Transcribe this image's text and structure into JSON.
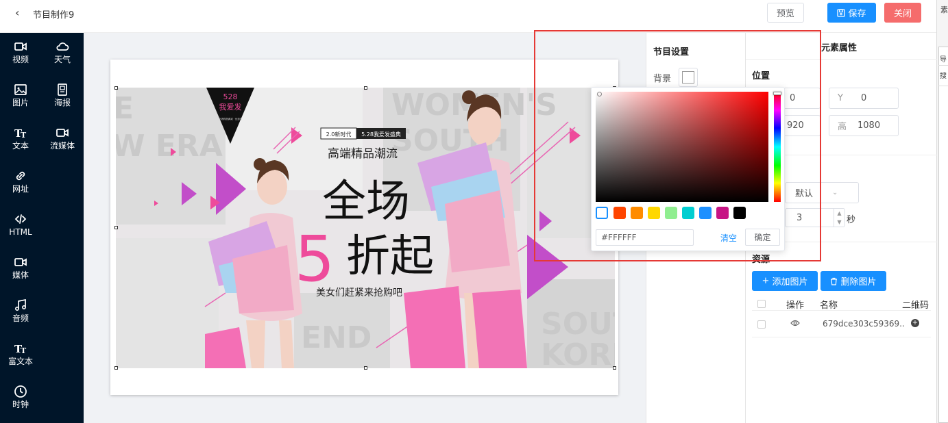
{
  "header": {
    "back_icon": "chevron-left-icon",
    "title": "节目制作9",
    "preview": "预览",
    "save": "保存",
    "close": "关闭"
  },
  "right_strip": {
    "t1": "素",
    "t2": "导",
    "t3": "搜"
  },
  "sidebar": {
    "items": [
      {
        "icon": "video-icon",
        "label": "视频"
      },
      {
        "icon": "cloud-icon",
        "label": "天气"
      },
      {
        "icon": "image-icon",
        "label": "图片"
      },
      {
        "icon": "poster-icon",
        "label": "海报"
      },
      {
        "icon": "text-icon",
        "label": "文本"
      },
      {
        "icon": "stream-icon",
        "label": "流媒体"
      },
      {
        "icon": "link-icon",
        "label": "网址"
      },
      {
        "icon": "code-icon",
        "label": "HTML"
      },
      {
        "icon": "media-icon",
        "label": "媒体"
      },
      {
        "icon": "music-icon",
        "label": "音频"
      },
      {
        "icon": "richtext-icon",
        "label": "富文本"
      },
      {
        "icon": "clock-icon",
        "label": "时钟"
      }
    ]
  },
  "banner": {
    "badge_num": "528",
    "badge_text": "我爱发",
    "badge_small": "全场购物满减 · 优惠多",
    "tag1": "2.0新时代",
    "tag2": "5.28我爱发盛典",
    "subtitle": "高端精品潮流",
    "headline1": "全场",
    "big5": "5",
    "headline2": "折起",
    "tagline": "美女们赶紧来抢购吧",
    "bg_words": [
      "E",
      "W ERA",
      "WOMEN'S",
      "SOUTH",
      "SOUT",
      "KORE",
      "END"
    ]
  },
  "program_settings": {
    "title": "节目设置",
    "bg_label": "背景"
  },
  "element_props": {
    "title": "元素属性",
    "position": "位置",
    "x_value": "0",
    "y_label": "Y",
    "y_value": "0",
    "w_value": "920",
    "h_label": "高",
    "h_value": "1080",
    "effect_value": "默认",
    "duration_value": "3",
    "duration_unit": "秒",
    "resources": "资源",
    "add_image": "添加图片",
    "delete_image": "删除图片",
    "table_headers": [
      "操作",
      "名称",
      "二维码"
    ],
    "rows": [
      {
        "name": "679dce303c59369..",
        "view_icon": "eye-icon",
        "qr_icon": "plus-circle-icon"
      }
    ]
  },
  "color_picker": {
    "hex": "#FFFFFF",
    "clear": "清空",
    "confirm": "确定",
    "presets": [
      "#FFFFFF",
      "#FF4500",
      "#FF8C00",
      "#FFD700",
      "#90EE90",
      "#00CED1",
      "#1E90FF",
      "#C71585",
      "#000000"
    ]
  },
  "colors": {
    "accent": "#1890ff",
    "danger": "#f56c6c",
    "sidebar_bg": "#001529",
    "highlight": "#e53935",
    "pink": "#e8408c"
  }
}
